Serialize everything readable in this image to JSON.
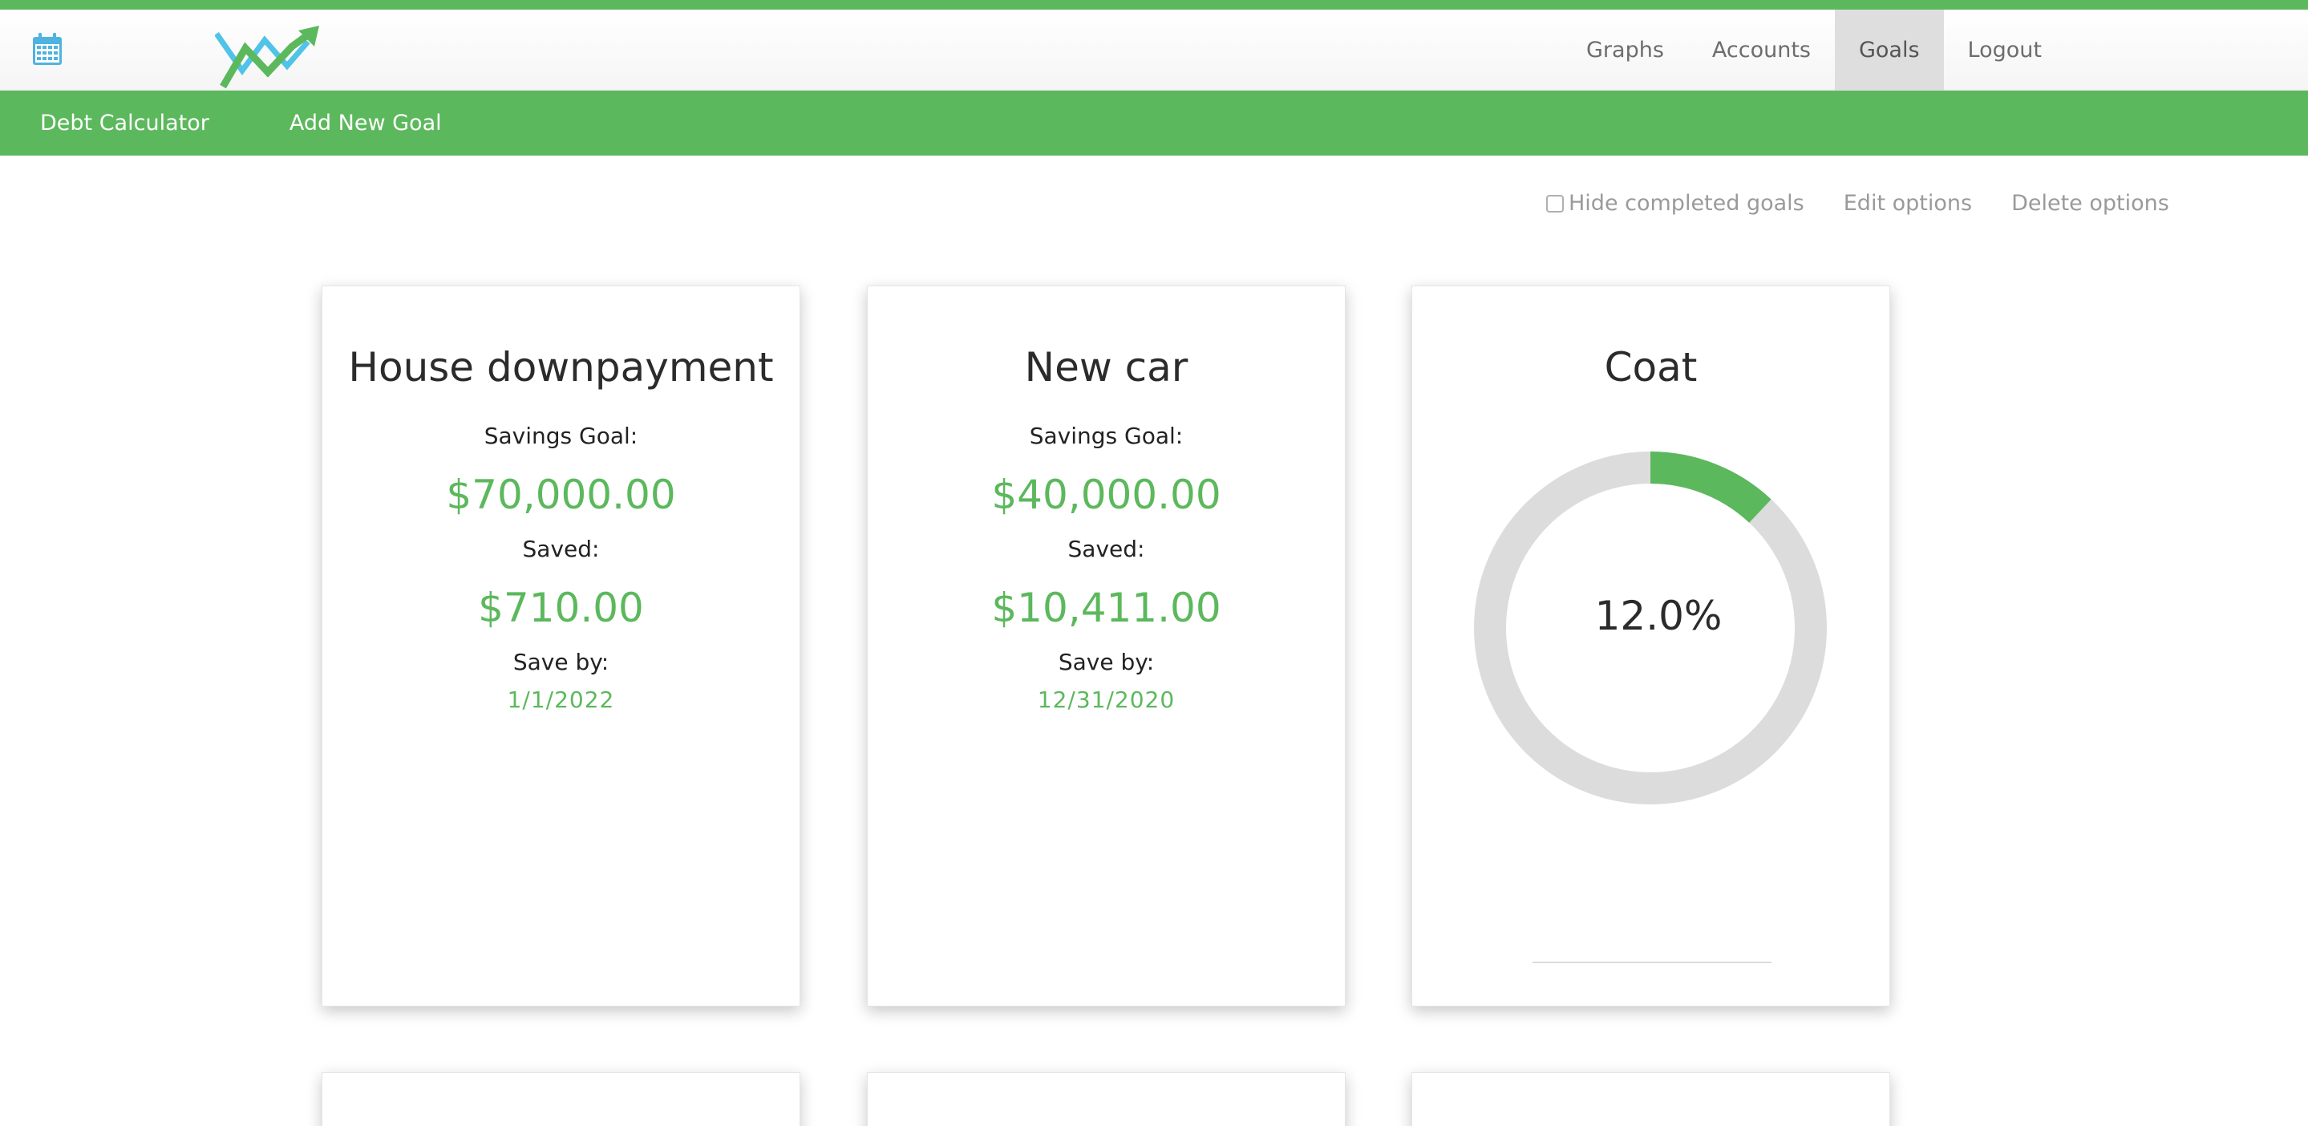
{
  "nav": {
    "links": [
      {
        "label": "Graphs"
      },
      {
        "label": "Accounts"
      },
      {
        "label": "Goals"
      },
      {
        "label": "Logout"
      }
    ],
    "active": "Goals"
  },
  "subnav": {
    "debt_calculator": "Debt Calculator",
    "add_new_goal": "Add New Goal"
  },
  "options": {
    "hide_completed": "Hide completed goals",
    "hide_completed_checked": false,
    "edit": "Edit options",
    "delete": "Delete options"
  },
  "goals": [
    {
      "title": "House downpayment",
      "savings_goal_label": "Savings Goal:",
      "savings_goal": "$70,000.00",
      "saved_label": "Saved:",
      "saved": "$710.00",
      "save_by_label": "Save by:",
      "save_by": "1/1/2022"
    },
    {
      "title": "New car",
      "savings_goal_label": "Savings Goal:",
      "savings_goal": "$40,000.00",
      "saved_label": "Saved:",
      "saved": "$10,411.00",
      "save_by_label": "Save by:",
      "save_by": "12/31/2020"
    },
    {
      "title": "Coat",
      "progress_text": "12.0%",
      "progress": 0.12
    }
  ],
  "colors": {
    "accent": "#5cb85c",
    "donut_track": "#dcdcdc",
    "calendar_icon": "#4fb3e0"
  },
  "icons": {
    "calendar": "calendar-icon",
    "logo": "app-logo"
  }
}
